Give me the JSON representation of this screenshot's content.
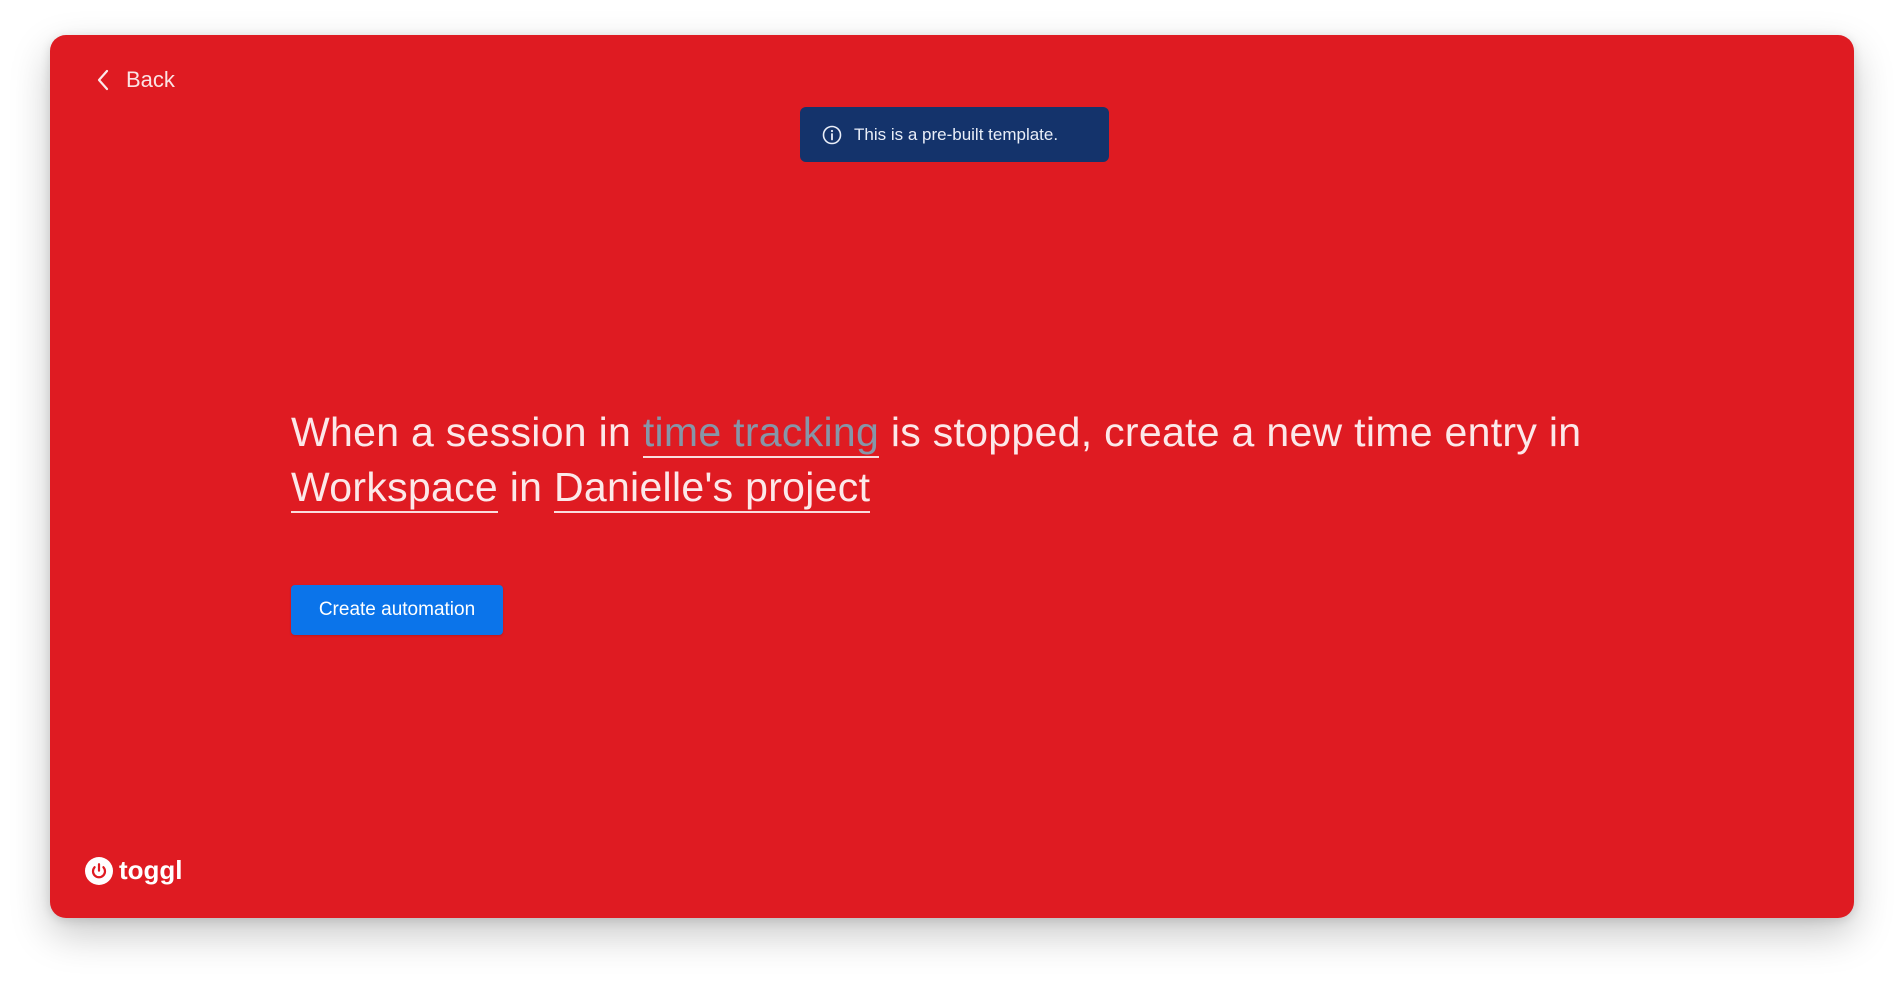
{
  "nav": {
    "back_label": "Back"
  },
  "banner": {
    "icon": "info-circle-icon",
    "text": "This is a pre-built template."
  },
  "automation": {
    "part1": "When a session in ",
    "trigger_app": "time tracking",
    "part2": " is stopped, create a new time entry in ",
    "workspace": "Workspace",
    "part3": " in ",
    "project": "Danielle's project"
  },
  "actions": {
    "create_label": "Create automation"
  },
  "brand": {
    "logo_text": "toggl",
    "icon": "toggl-power-icon"
  },
  "colors": {
    "background": "#df1b22",
    "banner": "#14336b",
    "primary_button": "#0b74ea",
    "muted_token": "#8696a8"
  }
}
